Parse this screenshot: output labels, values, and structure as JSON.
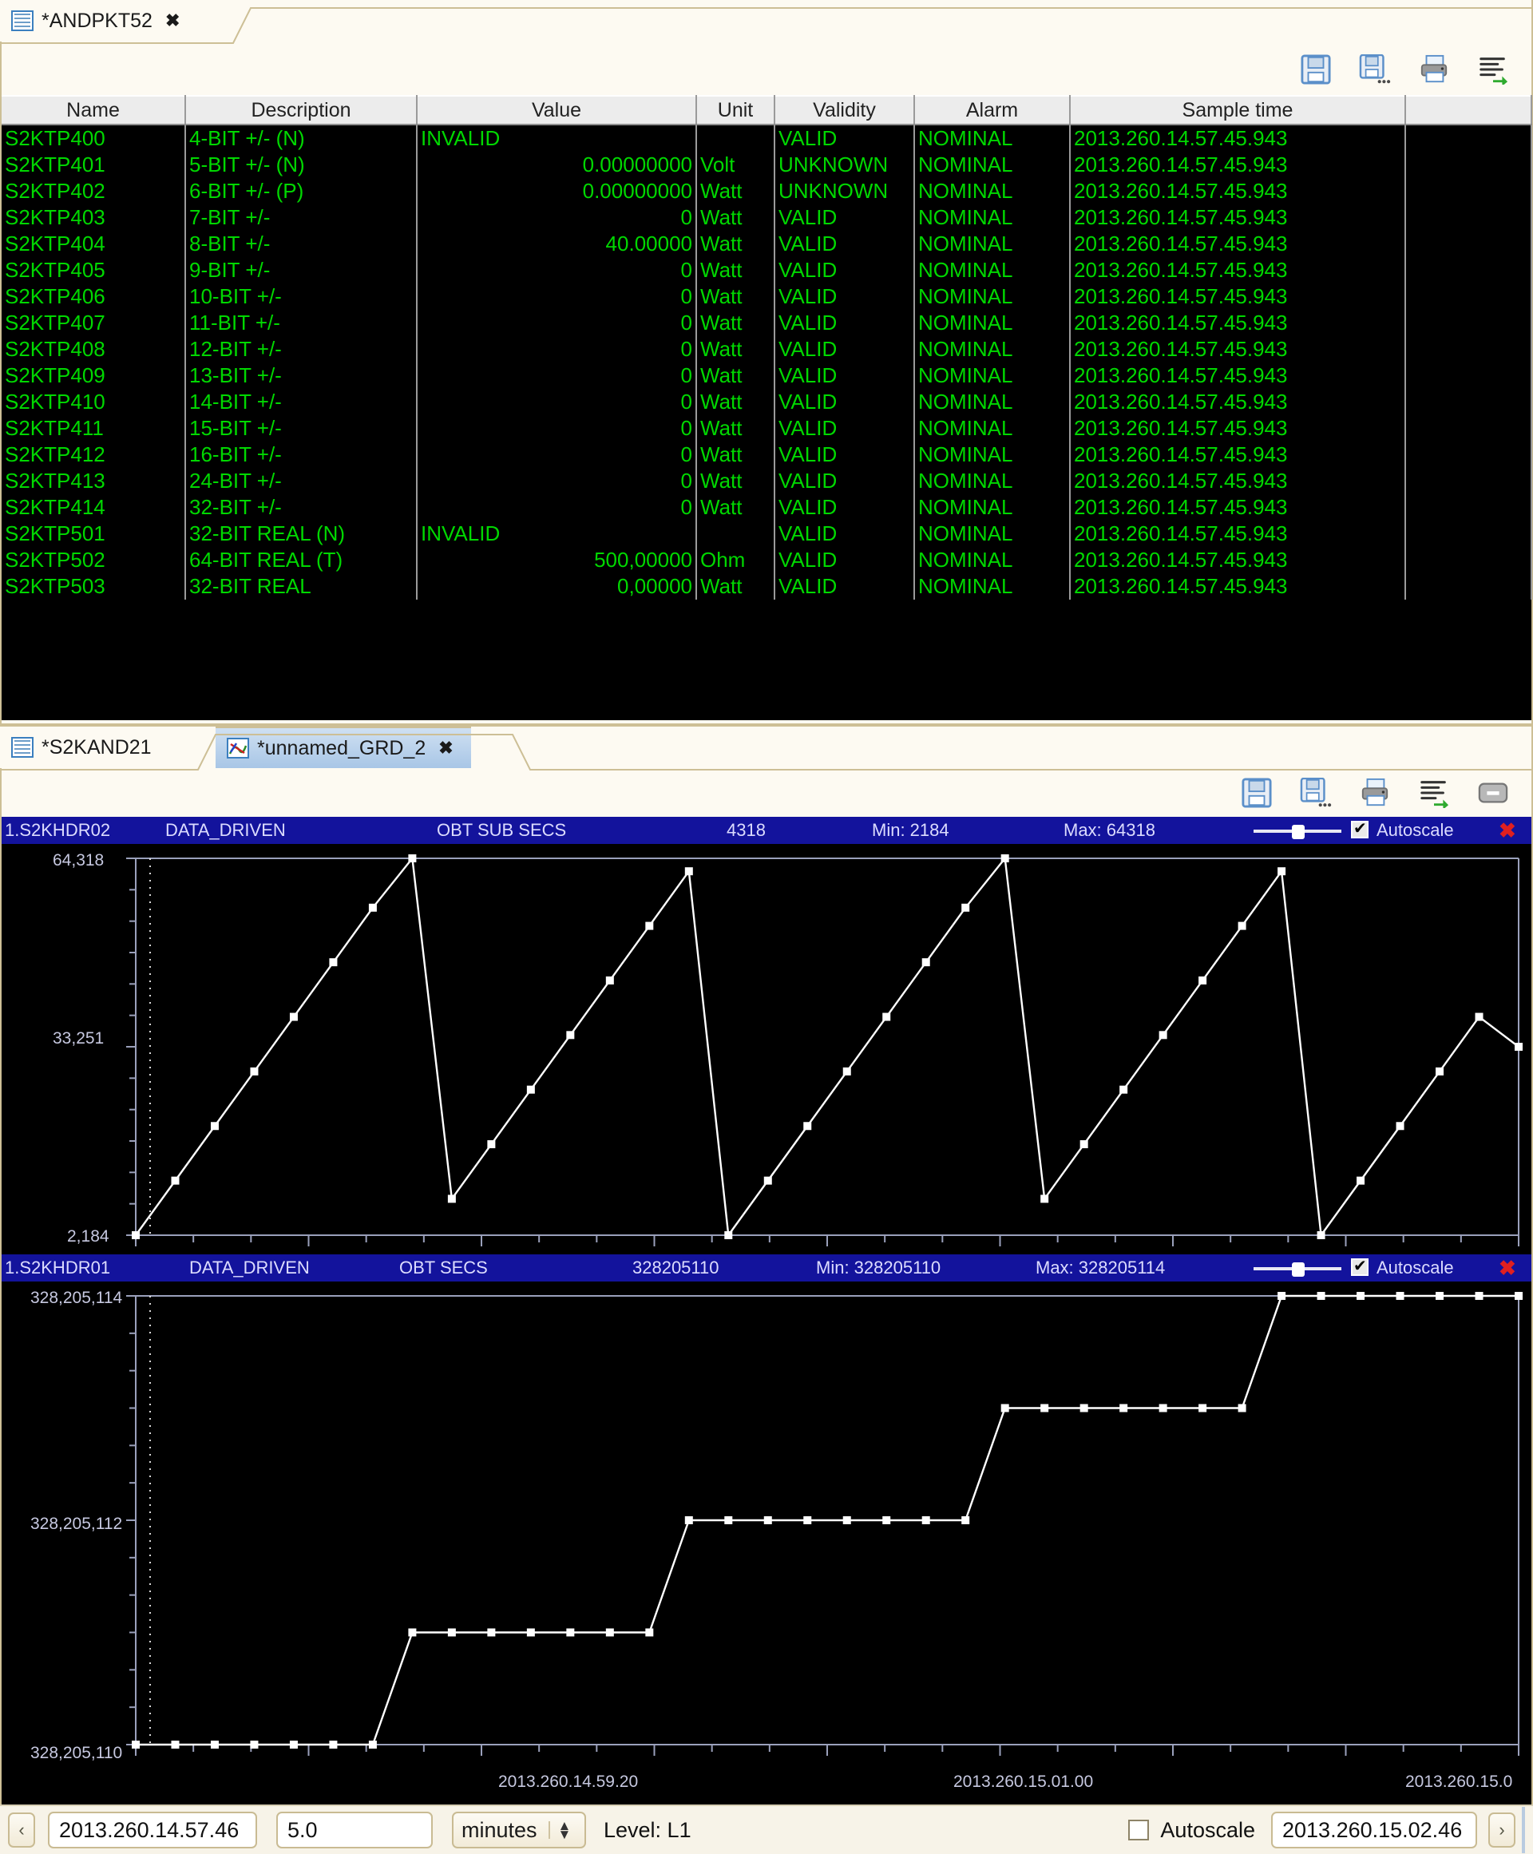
{
  "top_panel": {
    "tab": {
      "label": "*ANDPKT52",
      "icon": "table-icon",
      "close": "✖"
    },
    "toolbar": [
      {
        "name": "save-icon",
        "title": "Save"
      },
      {
        "name": "save-as-icon",
        "title": "Save As"
      },
      {
        "name": "print-icon",
        "title": "Print"
      },
      {
        "name": "export-icon",
        "title": "Export"
      }
    ],
    "table": {
      "columns": [
        "Name",
        "Description",
        "Value",
        "Unit",
        "Validity",
        "Alarm",
        "Sample time",
        ""
      ],
      "rows": [
        {
          "name": "S2KTP400",
          "desc": "4-BIT +/- (N)",
          "value": "INVALID",
          "value_align": "left",
          "value_bg": "green",
          "unit": "",
          "validity": "VALID",
          "alarm": "NOMINAL",
          "alarm_bg": "green",
          "time": "2013.260.14.57.45.943"
        },
        {
          "name": "S2KTP401",
          "desc": "5-BIT +/- (N)",
          "value": "0.00000000",
          "value_align": "right",
          "value_bg": "blue",
          "unit": "Volt",
          "validity": "UNKNOWN",
          "alarm": "NOMINAL",
          "alarm_bg": "blue",
          "time": "2013.260.14.57.45.943"
        },
        {
          "name": "S2KTP402",
          "desc": "6-BIT +/- (P)",
          "value": "0.00000000",
          "value_align": "right",
          "value_bg": "blue",
          "unit": "Watt",
          "validity": "UNKNOWN",
          "alarm": "NOMINAL",
          "alarm_bg": "blue",
          "time": "2013.260.14.57.45.943"
        },
        {
          "name": "S2KTP403",
          "desc": "7-BIT +/-",
          "value": "0",
          "value_align": "right",
          "value_bg": "green",
          "unit": "Watt",
          "validity": "VALID",
          "alarm": "NOMINAL",
          "alarm_bg": "green",
          "time": "2013.260.14.57.45.943"
        },
        {
          "name": "S2KTP404",
          "desc": "8-BIT +/-",
          "value": "40.00000",
          "value_align": "right",
          "value_bg": "green",
          "unit": "Watt",
          "validity": "VALID",
          "alarm": "NOMINAL",
          "alarm_bg": "green",
          "time": "2013.260.14.57.45.943"
        },
        {
          "name": "S2KTP405",
          "desc": "9-BIT +/-",
          "value": "0",
          "value_align": "right",
          "value_bg": "green",
          "unit": "Watt",
          "validity": "VALID",
          "alarm": "NOMINAL",
          "alarm_bg": "green",
          "time": "2013.260.14.57.45.943"
        },
        {
          "name": "S2KTP406",
          "desc": "10-BIT +/-",
          "value": "0",
          "value_align": "right",
          "value_bg": "green",
          "unit": "Watt",
          "validity": "VALID",
          "alarm": "NOMINAL",
          "alarm_bg": "green",
          "time": "2013.260.14.57.45.943"
        },
        {
          "name": "S2KTP407",
          "desc": "11-BIT +/-",
          "value": "0",
          "value_align": "right",
          "value_bg": "green",
          "unit": "Watt",
          "validity": "VALID",
          "alarm": "NOMINAL",
          "alarm_bg": "green",
          "time": "2013.260.14.57.45.943"
        },
        {
          "name": "S2KTP408",
          "desc": "12-BIT +/-",
          "value": "0",
          "value_align": "right",
          "value_bg": "green",
          "unit": "Watt",
          "validity": "VALID",
          "alarm": "NOMINAL",
          "alarm_bg": "green",
          "time": "2013.260.14.57.45.943"
        },
        {
          "name": "S2KTP409",
          "desc": "13-BIT +/-",
          "value": "0",
          "value_align": "right",
          "value_bg": "green",
          "unit": "Watt",
          "validity": "VALID",
          "alarm": "NOMINAL",
          "alarm_bg": "green",
          "time": "2013.260.14.57.45.943"
        },
        {
          "name": "S2KTP410",
          "desc": "14-BIT +/-",
          "value": "0",
          "value_align": "right",
          "value_bg": "green",
          "unit": "Watt",
          "validity": "VALID",
          "alarm": "NOMINAL",
          "alarm_bg": "green",
          "time": "2013.260.14.57.45.943"
        },
        {
          "name": "S2KTP411",
          "desc": "15-BIT +/-",
          "value": "0",
          "value_align": "right",
          "value_bg": "green",
          "unit": "Watt",
          "validity": "VALID",
          "alarm": "NOMINAL",
          "alarm_bg": "green",
          "time": "2013.260.14.57.45.943"
        },
        {
          "name": "S2KTP412",
          "desc": "16-BIT +/-",
          "value": "0",
          "value_align": "right",
          "value_bg": "green",
          "unit": "Watt",
          "validity": "VALID",
          "alarm": "NOMINAL",
          "alarm_bg": "green",
          "time": "2013.260.14.57.45.943"
        },
        {
          "name": "S2KTP413",
          "desc": "24-BIT +/-",
          "value": "0",
          "value_align": "right",
          "value_bg": "green",
          "unit": "Watt",
          "validity": "VALID",
          "alarm": "NOMINAL",
          "alarm_bg": "green",
          "time": "2013.260.14.57.45.943"
        },
        {
          "name": "S2KTP414",
          "desc": "32-BIT +/-",
          "value": "0",
          "value_align": "right",
          "value_bg": "green",
          "unit": "Watt",
          "validity": "VALID",
          "alarm": "NOMINAL",
          "alarm_bg": "green",
          "time": "2013.260.14.57.45.943"
        },
        {
          "name": "S2KTP501",
          "desc": "32-BIT REAL (N)",
          "value": "INVALID",
          "value_align": "left",
          "value_bg": "green",
          "unit": "",
          "validity": "VALID",
          "alarm": "NOMINAL",
          "alarm_bg": "green",
          "time": "2013.260.14.57.45.943"
        },
        {
          "name": "S2KTP502",
          "desc": "64-BIT REAL (T)",
          "value": "500,00000",
          "value_align": "right",
          "value_bg": "green",
          "unit": "Ohm",
          "validity": "VALID",
          "alarm": "NOMINAL",
          "alarm_bg": "green",
          "time": "2013.260.14.57.45.943"
        },
        {
          "name": "S2KTP503",
          "desc": "32-BIT REAL",
          "value": "0,00000",
          "value_align": "right",
          "value_bg": "green",
          "unit": "Watt",
          "validity": "VALID",
          "alarm": "NOMINAL",
          "alarm_bg": "green",
          "time": "2013.260.14.57.45.943"
        }
      ]
    }
  },
  "bottom_panel": {
    "tabs": [
      {
        "label": "*S2KAND21",
        "icon": "table-icon",
        "active": false
      },
      {
        "label": "*unnamed_GRD_2",
        "icon": "chart-icon",
        "active": true,
        "close": "✖"
      }
    ],
    "toolbar": [
      {
        "name": "save-icon"
      },
      {
        "name": "save-as-icon"
      },
      {
        "name": "print-icon"
      },
      {
        "name": "export-icon"
      },
      {
        "name": "minimize-icon"
      }
    ]
  },
  "chart_data": [
    {
      "type": "line",
      "title": "1.S2KHDR02",
      "mode": "DATA_DRIVEN",
      "parameter": "OBT SUB SECS",
      "current": "4318",
      "min_label": "Min: 2184",
      "max_label": "Max: 64318",
      "autoscale_label": "Autoscale",
      "autoscale": true,
      "ylabel": "",
      "xlabel": "",
      "yticks": [
        "64,318",
        "33,251",
        "2,184"
      ],
      "ylim": [
        2184,
        64318
      ],
      "grid": false,
      "legend": "none",
      "x": [
        0,
        1,
        2,
        3,
        4,
        5,
        6,
        7,
        8,
        9,
        10,
        11,
        12,
        13,
        14,
        15,
        16,
        17,
        18,
        19,
        20,
        21,
        22,
        23,
        24,
        25,
        26,
        27,
        28,
        29,
        30,
        31,
        32,
        33,
        34,
        35
      ],
      "values": [
        2184,
        11184,
        20184,
        29184,
        38184,
        47184,
        56184,
        64318,
        8184,
        17184,
        26184,
        35184,
        44184,
        53184,
        62184,
        2184,
        11184,
        20184,
        29184,
        38184,
        47184,
        56184,
        64318,
        8184,
        17184,
        26184,
        35184,
        44184,
        53184,
        62184,
        2184,
        11184,
        20184,
        29184,
        38184,
        33251
      ]
    },
    {
      "type": "line",
      "title": "1.S2KHDR01",
      "mode": "DATA_DRIVEN",
      "parameter": "OBT SECS",
      "current": "328205110",
      "min_label": "Min: 328205110",
      "max_label": "Max: 328205114",
      "autoscale_label": "Autoscale",
      "autoscale": true,
      "ylabel": "",
      "xlabel": "",
      "yticks": [
        "328,205,114",
        "328,205,112",
        "328,205,110"
      ],
      "ylim": [
        328205110,
        328205114
      ],
      "grid": false,
      "legend": "none",
      "xticklabels": [
        "2013.260.14.59.20",
        "2013.260.15.01.00",
        "2013.260.15.0"
      ],
      "x": [
        0,
        1,
        2,
        3,
        4,
        5,
        6,
        7,
        8,
        9,
        10,
        11,
        12,
        13,
        14,
        15,
        16,
        17,
        18,
        19,
        20,
        21,
        22,
        23,
        24,
        25,
        26,
        27,
        28,
        29,
        30,
        31,
        32,
        33,
        34,
        35
      ],
      "values": [
        328205110,
        328205110,
        328205110,
        328205110,
        328205110,
        328205110,
        328205110,
        328205111,
        328205111,
        328205111,
        328205111,
        328205111,
        328205111,
        328205111,
        328205112,
        328205112,
        328205112,
        328205112,
        328205112,
        328205112,
        328205112,
        328205112,
        328205113,
        328205113,
        328205113,
        328205113,
        328205113,
        328205113,
        328205113,
        328205114,
        328205114,
        328205114,
        328205114,
        328205114,
        328205114,
        328205114
      ]
    }
  ],
  "statusbar": {
    "prev_label": "‹",
    "start_time": "2013.260.14.57.46",
    "span_value": "5.0",
    "span_unit": "minutes",
    "level": "Level: L1",
    "autoscale_label": "Autoscale",
    "autoscale_checked": false,
    "end_time": "2013.260.15.02.46",
    "next_label": "›"
  },
  "colors": {
    "accent_blue": "#13139c",
    "alarm_green": "#00ee00",
    "select_blue": "#0000f0",
    "text_green": "#00d800",
    "tab_border": "#cdbf96"
  }
}
